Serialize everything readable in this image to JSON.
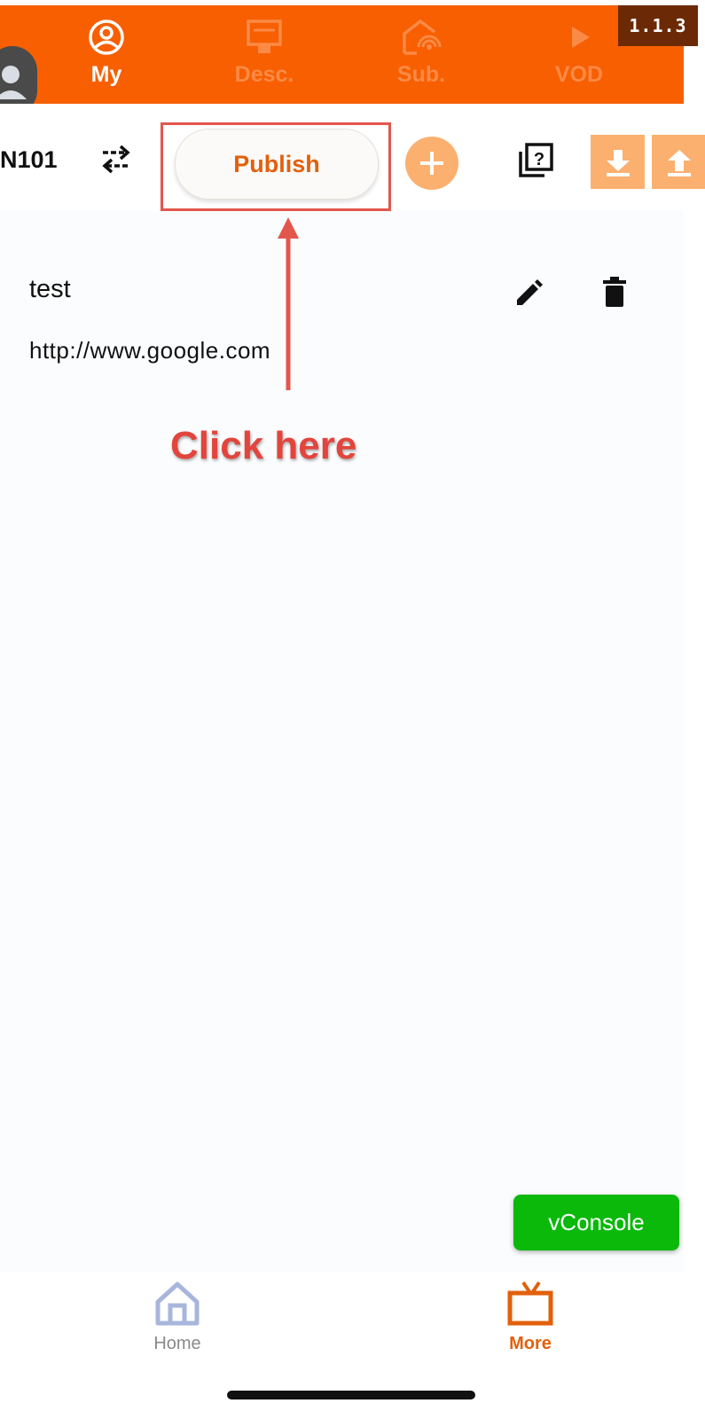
{
  "top_tabs": [
    {
      "label": "My",
      "icon": "user-circle-icon",
      "active": true
    },
    {
      "label": "Desc.",
      "icon": "certificate-icon",
      "active": false
    },
    {
      "label": "Sub.",
      "icon": "home-broadcast-icon",
      "active": false
    },
    {
      "label": "VOD",
      "icon": "play-icon",
      "active": false
    }
  ],
  "version": "1.1.3",
  "toolbar": {
    "device_id": "N101",
    "publish_label": "Publish"
  },
  "item": {
    "name": "test",
    "url": "http://www.google.com"
  },
  "annotation": {
    "text": "Click here"
  },
  "vconsole_label": "vConsole",
  "bottom_nav": [
    {
      "label": "Home",
      "icon": "home-icon",
      "active": false
    },
    {
      "label": "More",
      "icon": "tv-icon",
      "active": true
    }
  ],
  "colors": {
    "brand": "#f75f00",
    "accent_light": "#fbb06f",
    "annotation_red": "#e2453c",
    "vconsole_green": "#0ab90a"
  }
}
